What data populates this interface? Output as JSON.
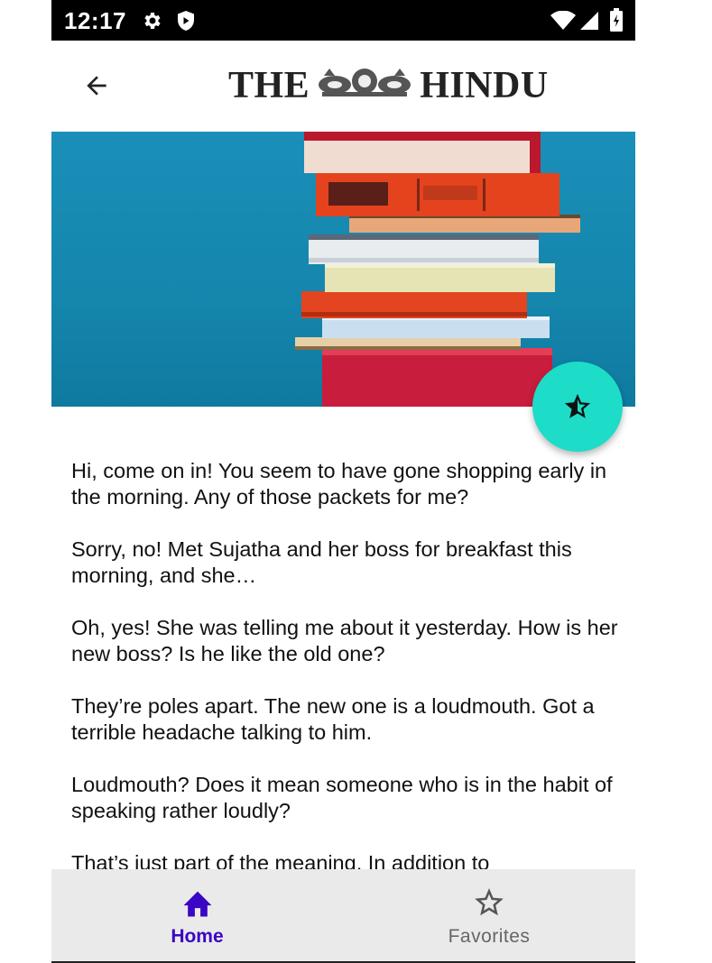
{
  "status_bar": {
    "time": "12:17",
    "icons": [
      "gear-icon",
      "shield-icon",
      "wifi-icon",
      "signal-icon",
      "battery-icon"
    ]
  },
  "app_bar": {
    "back_icon": "arrow-left-icon",
    "logo_left": "THE",
    "logo_right": "HINDU"
  },
  "hero_image": {
    "subject": "stack-of-books"
  },
  "fab": {
    "icon": "star-half-icon",
    "color": "#1ddcc8"
  },
  "article": {
    "paragraphs": [
      "Hi, come on in! You seem to have gone shopping early in the morning. Any of those packets for me?",
      "Sorry, no! Met Sujatha and her boss for breakfast this morning, and she…",
      "Oh, yes! She was telling me about it yesterday. How is her new boss? Is he like the old one?",
      "They’re poles apart. The new one is a loudmouth. Got a terrible headache talking to him.",
      "Loudmouth? Does it mean someone who is in the habit of speaking rather loudly?",
      "That’s just part of the meaning. In addition to"
    ]
  },
  "bottom_nav": {
    "items": [
      {
        "label": "Home",
        "icon": "home-icon",
        "selected": true,
        "color": "#3b05c4"
      },
      {
        "label": "Favorites",
        "icon": "star-outline-icon",
        "selected": false,
        "color": "#666666"
      }
    ]
  }
}
